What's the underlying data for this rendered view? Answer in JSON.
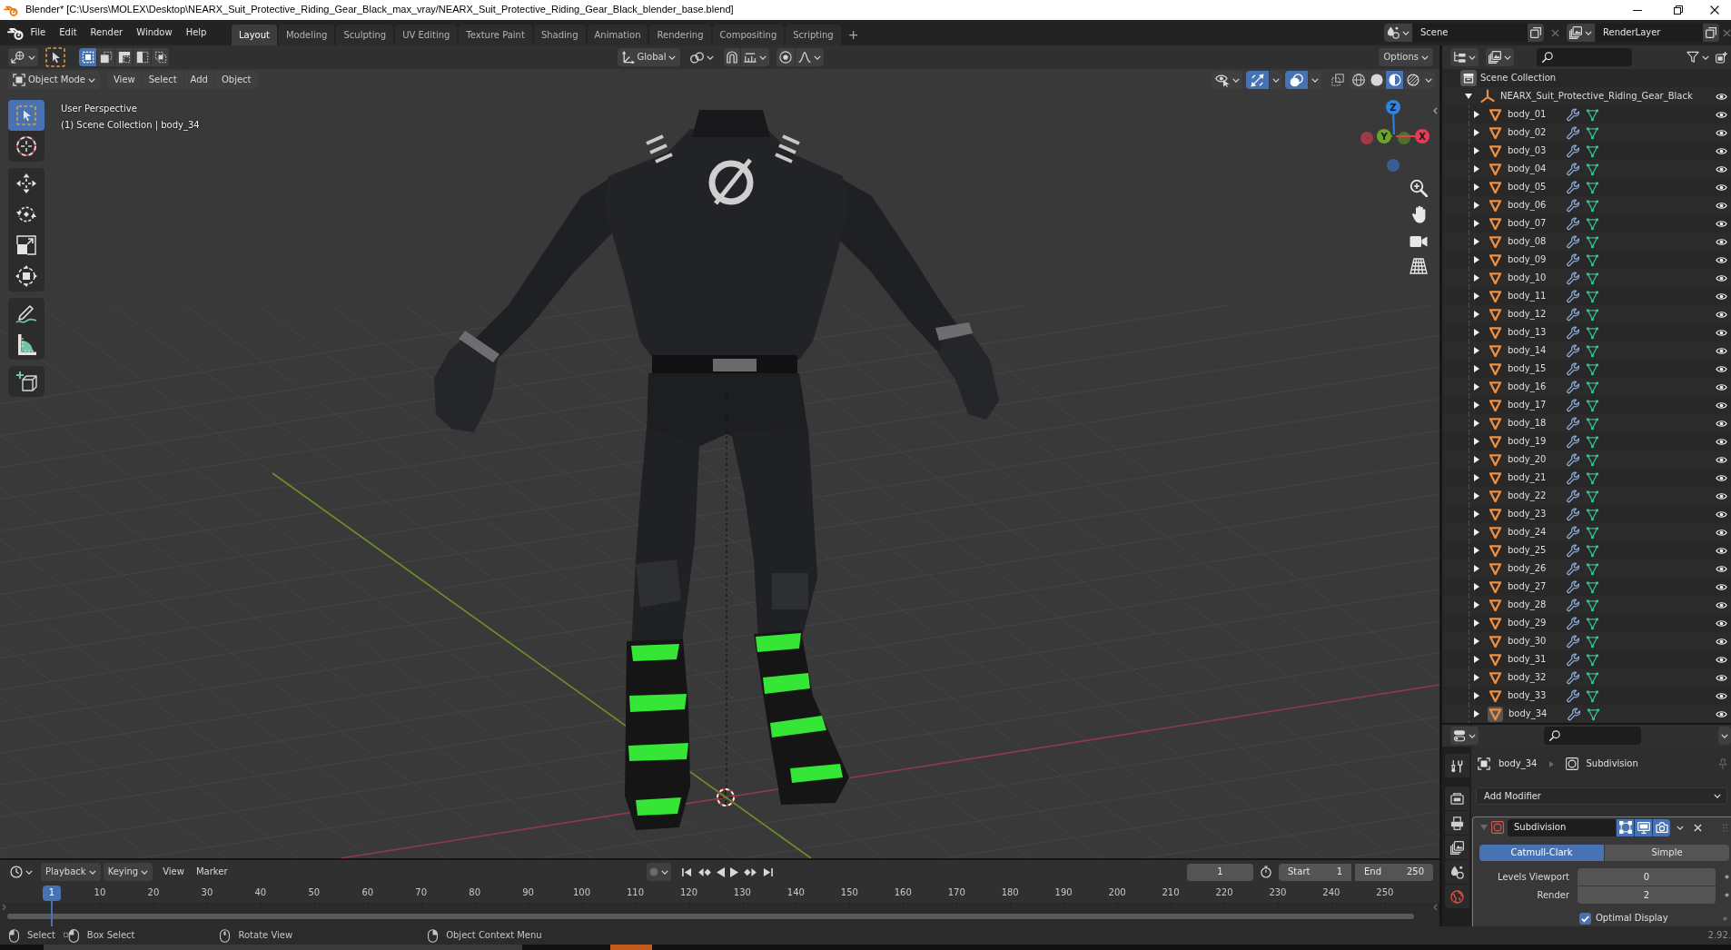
{
  "window": {
    "title": "Blender* [C:\\Users\\MOLEX\\Desktop\\NEARX_Suit_Protective_Riding_Gear_Black_max_vray/NEARX_Suit_Protective_Riding_Gear_Black_blender_base.blend]"
  },
  "menu_bar": [
    "File",
    "Edit",
    "Render",
    "Window",
    "Help"
  ],
  "workspace_tabs": [
    {
      "label": "Layout",
      "selected": true
    },
    {
      "label": "Modeling",
      "selected": false
    },
    {
      "label": "Sculpting",
      "selected": false
    },
    {
      "label": "UV Editing",
      "selected": false
    },
    {
      "label": "Texture Paint",
      "selected": false
    },
    {
      "label": "Shading",
      "selected": false
    },
    {
      "label": "Animation",
      "selected": false
    },
    {
      "label": "Rendering",
      "selected": false
    },
    {
      "label": "Compositing",
      "selected": false
    },
    {
      "label": "Scripting",
      "selected": false
    }
  ],
  "add_workspace": "+",
  "scene": "Scene",
  "view_layer": "RenderLayer",
  "tool_header": {
    "select_modes": [
      {
        "kind": "set",
        "selected": true
      },
      {
        "kind": "extend",
        "selected": false
      },
      {
        "kind": "subtract",
        "selected": false
      },
      {
        "kind": "difference",
        "selected": false
      },
      {
        "kind": "intersect",
        "selected": false
      }
    ],
    "orientation": "Global",
    "snap": false,
    "proportional_editing": false,
    "options": "Options"
  },
  "viewport_header": {
    "mode": "Object Mode",
    "menus": [
      "View",
      "Select",
      "Add",
      "Object"
    ],
    "gizmos": true,
    "overlays": true,
    "xray": false,
    "shading_modes": [
      {
        "kind": "wireframe",
        "selected": false
      },
      {
        "kind": "solid",
        "selected": false
      },
      {
        "kind": "material",
        "selected": true
      },
      {
        "kind": "rendered",
        "selected": false
      }
    ]
  },
  "toolbar": [
    {
      "tools": [
        {
          "kind": "select-box",
          "selected": true
        },
        {
          "kind": "cursor",
          "selected": false
        }
      ]
    },
    {
      "tools": [
        {
          "kind": "move",
          "selected": false
        },
        {
          "kind": "rotate",
          "selected": false
        },
        {
          "kind": "scale",
          "selected": false
        },
        {
          "kind": "transform",
          "selected": false
        }
      ]
    },
    {
      "tools": [
        {
          "kind": "annotate",
          "selected": false
        },
        {
          "kind": "measure",
          "selected": false
        }
      ]
    },
    {
      "tools": [
        {
          "kind": "add-cube",
          "selected": false
        }
      ]
    }
  ],
  "viewport": {
    "view_name": "User Perspective",
    "collection_info": "(1) Scene Collection | body_34",
    "axes": [
      {
        "kind": "z",
        "label": "Z"
      },
      {
        "kind": "y",
        "label": "Y"
      },
      {
        "kind": "x",
        "label": "X"
      }
    ]
  },
  "outliner": {
    "root": "Scene Collection",
    "collections": [
      {
        "name": "NEARX_Suit_Protective_Riding_Gear_Black",
        "expanded": true,
        "children": [
          {
            "name": "body_01",
            "expanded": false,
            "active": false
          },
          {
            "name": "body_02",
            "expanded": false,
            "active": false
          },
          {
            "name": "body_03",
            "expanded": false,
            "active": false
          },
          {
            "name": "body_04",
            "expanded": false,
            "active": false
          },
          {
            "name": "body_05",
            "expanded": false,
            "active": false
          },
          {
            "name": "body_06",
            "expanded": false,
            "active": false
          },
          {
            "name": "body_07",
            "expanded": false,
            "active": false
          },
          {
            "name": "body_08",
            "expanded": false,
            "active": false
          },
          {
            "name": "body_09",
            "expanded": false,
            "active": false
          },
          {
            "name": "body_10",
            "expanded": false,
            "active": false
          },
          {
            "name": "body_11",
            "expanded": false,
            "active": false
          },
          {
            "name": "body_12",
            "expanded": false,
            "active": false
          },
          {
            "name": "body_13",
            "expanded": false,
            "active": false
          },
          {
            "name": "body_14",
            "expanded": false,
            "active": false
          },
          {
            "name": "body_15",
            "expanded": false,
            "active": false
          },
          {
            "name": "body_16",
            "expanded": false,
            "active": false
          },
          {
            "name": "body_17",
            "expanded": false,
            "active": false
          },
          {
            "name": "body_18",
            "expanded": false,
            "active": false
          },
          {
            "name": "body_19",
            "expanded": false,
            "active": false
          },
          {
            "name": "body_20",
            "expanded": false,
            "active": false
          },
          {
            "name": "body_21",
            "expanded": false,
            "active": false
          },
          {
            "name": "body_22",
            "expanded": false,
            "active": false
          },
          {
            "name": "body_23",
            "expanded": false,
            "active": false
          },
          {
            "name": "body_24",
            "expanded": false,
            "active": false
          },
          {
            "name": "body_25",
            "expanded": false,
            "active": false
          },
          {
            "name": "body_26",
            "expanded": false,
            "active": false
          },
          {
            "name": "body_27",
            "expanded": false,
            "active": false
          },
          {
            "name": "body_28",
            "expanded": false,
            "active": false
          },
          {
            "name": "body_29",
            "expanded": false,
            "active": false
          },
          {
            "name": "body_30",
            "expanded": false,
            "active": false
          },
          {
            "name": "body_31",
            "expanded": false,
            "active": false
          },
          {
            "name": "body_32",
            "expanded": false,
            "active": false
          },
          {
            "name": "body_33",
            "expanded": false,
            "active": false
          },
          {
            "name": "body_34",
            "expanded": false,
            "active": true
          }
        ]
      }
    ]
  },
  "properties": {
    "tabs": [
      {
        "kind": "tool"
      },
      {
        "kind": "render"
      },
      {
        "kind": "output"
      },
      {
        "kind": "view_layer"
      },
      {
        "kind": "scene"
      },
      {
        "kind": "world"
      }
    ],
    "object": "body_34",
    "active_modifier": "Subdivision",
    "add_modifier": "Add Modifier",
    "modifiers": [
      {
        "name": "Subdivision",
        "expanded": true,
        "show_in_editmode": true,
        "show_viewport": true,
        "show_render": true,
        "subdivision_types": [
          {
            "label": "Catmull-Clark",
            "selected": true
          },
          {
            "label": "Simple",
            "selected": false
          }
        ],
        "fields": [
          {
            "label": "Levels Viewport",
            "value": "0"
          },
          {
            "label": "Render",
            "value": "2"
          }
        ],
        "options": [
          {
            "label": "Optimal Display",
            "checked": true
          }
        ]
      }
    ]
  },
  "timeline": {
    "menus": [
      {
        "label": "Playback",
        "kind": "dropdown"
      },
      {
        "label": "Keying",
        "kind": "dropdown"
      },
      {
        "label": "View",
        "kind": "menu"
      },
      {
        "label": "Marker",
        "kind": "menu"
      }
    ],
    "auto_keying": false,
    "current_frame": "1",
    "start": {
      "label": "Start",
      "value": "1"
    },
    "end": {
      "label": "End",
      "value": "250"
    },
    "playhead": "1",
    "ruler": [
      "10",
      "20",
      "30",
      "40",
      "50",
      "60",
      "70",
      "80",
      "90",
      "100",
      "110",
      "120",
      "130",
      "140",
      "150",
      "160",
      "170",
      "180",
      "190",
      "200",
      "210",
      "220",
      "230",
      "240",
      "250"
    ]
  },
  "status_bar": {
    "hints": [
      {
        "kind": "left",
        "label": "Select"
      },
      {
        "kind": "left-drag",
        "label": "Box Select"
      },
      {
        "kind": "middle",
        "label": "Rotate View"
      },
      {
        "kind": "right",
        "label": "Object Context Menu"
      }
    ],
    "version": "2.92."
  }
}
